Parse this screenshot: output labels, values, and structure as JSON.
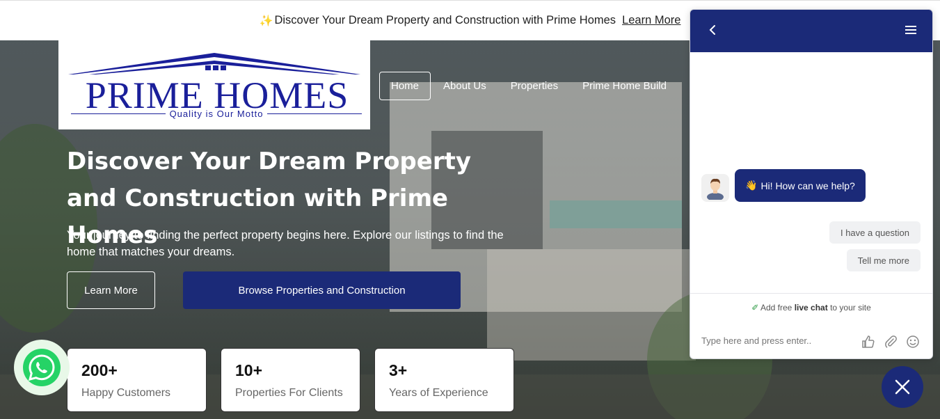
{
  "announcement": {
    "sparkle": "✨",
    "text": "Discover Your Dream Property and Construction with Prime Homes",
    "link": "Learn More"
  },
  "logo": {
    "name": "PRIME HOMES",
    "motto": "Quality is Our Motto"
  },
  "nav": {
    "items": [
      "Home",
      "About Us",
      "Properties",
      "Prime Home Build"
    ],
    "active": "Home"
  },
  "hero": {
    "title": "Discover Your Dream Property and Construction with Prime Homes",
    "subtitle": "Your journey to finding the perfect property begins here. Explore our listings to find the home that matches your dreams.",
    "btn_learn": "Learn More",
    "btn_browse": "Browse Properties and Construction"
  },
  "stats": [
    {
      "value": "200+",
      "label": "Happy Customers"
    },
    {
      "value": "10+",
      "label": "Properties For Clients"
    },
    {
      "value": "3+",
      "label": "Years of Experience"
    }
  ],
  "chat": {
    "greeting_emoji": "👋",
    "greeting": "Hi! How can we help?",
    "quick_replies": [
      "I have a question",
      "Tell me more"
    ],
    "promo_pre": "Add free",
    "promo_bold": "live chat",
    "promo_post": "to your site",
    "input_placeholder": "Type here and press enter.."
  },
  "colors": {
    "brand_navy": "#1b2a78",
    "logo_blue": "#1a1f9a",
    "whatsapp_green": "#25d366"
  },
  "icons": [
    "back-arrow-icon",
    "menu-icon",
    "thumbs-up-icon",
    "paperclip-icon",
    "emoji-icon",
    "close-icon",
    "whatsapp-icon",
    "brush-icon"
  ]
}
